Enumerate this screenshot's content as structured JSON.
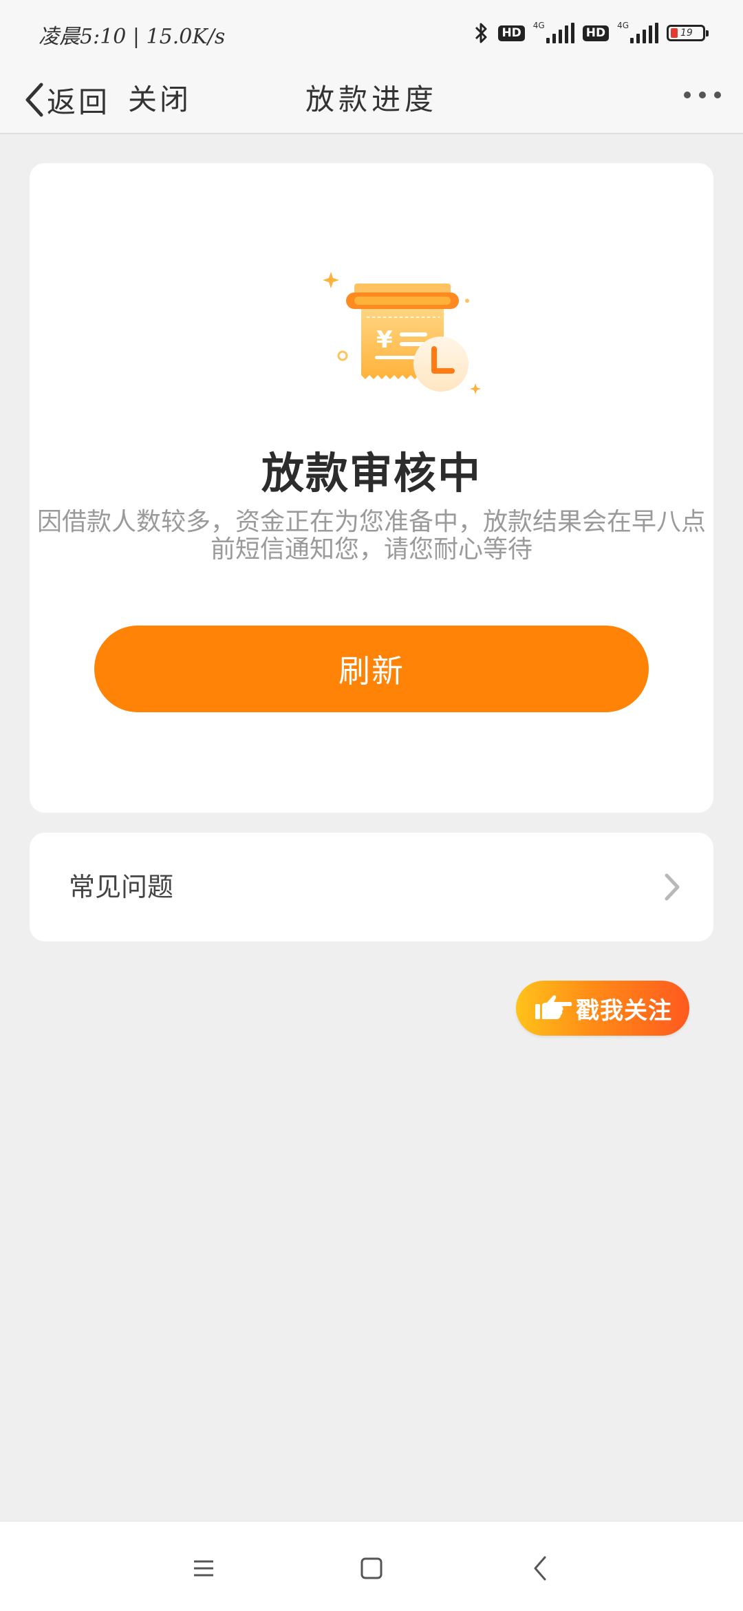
{
  "status_bar": {
    "time": "凌晨5:10 | 15.0K/s",
    "hd_badge": "HD",
    "network": "4G",
    "battery_level": "19"
  },
  "navbar": {
    "back_label": "返回",
    "close_label": "关闭",
    "title": "放款进度"
  },
  "status_card": {
    "title": "放款审核中",
    "description": "因借款人数较多，资金正在为您准备中，放款结果会在早八点前短信通知您，请您耐心等待",
    "refresh_label": "刷新"
  },
  "faq": {
    "label": "常见问题"
  },
  "follow_button": {
    "label": "戳我关注"
  },
  "colors": {
    "accent": "#ff8307",
    "background": "#efefef"
  }
}
